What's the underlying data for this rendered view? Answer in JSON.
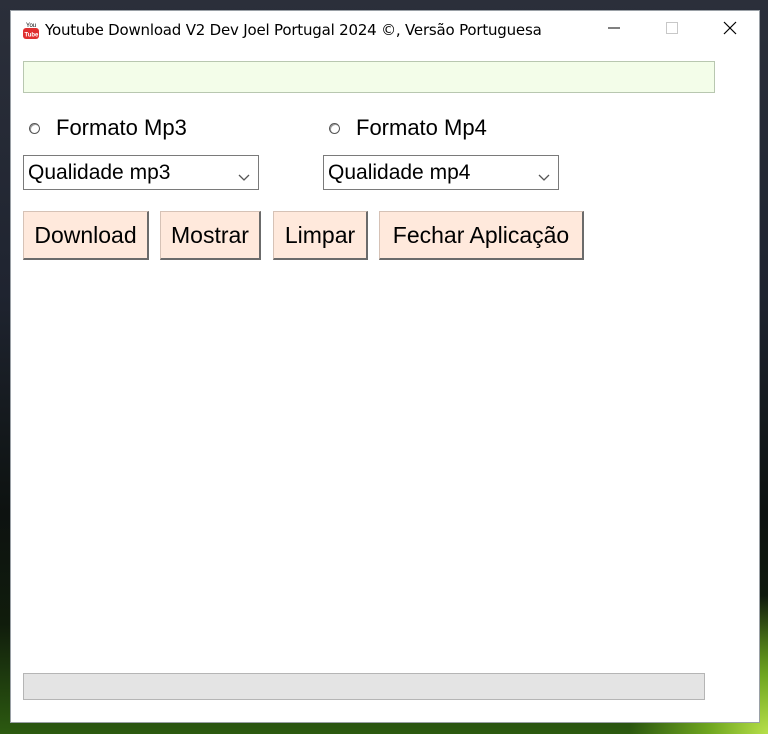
{
  "window": {
    "title": "Youtube Download V2 Dev Joel Portugal 2024 ©, Versão Portuguesa"
  },
  "url_input": {
    "value": "",
    "placeholder": ""
  },
  "radios": [
    {
      "label": "Formato Mp3",
      "selected": false
    },
    {
      "label": "Formato Mp4",
      "selected": false
    }
  ],
  "selects": [
    {
      "selected": "Qualidade mp3"
    },
    {
      "selected": "Qualidade mp4"
    }
  ],
  "buttons": {
    "download": "Download",
    "show": "Mostrar",
    "clear": "Limpar",
    "close_app": "Fechar Aplicação"
  },
  "progress": {
    "value": 0
  },
  "colors": {
    "input_bg": "#f3fde9",
    "button_bg": "#ffe9dc",
    "progress_bg": "#e4e4e4",
    "app_icon_red": "#e02f2f"
  },
  "icons": {
    "app": "youtube-icon",
    "minimize": "minimize-icon",
    "maximize": "maximize-icon",
    "close": "close-icon"
  }
}
